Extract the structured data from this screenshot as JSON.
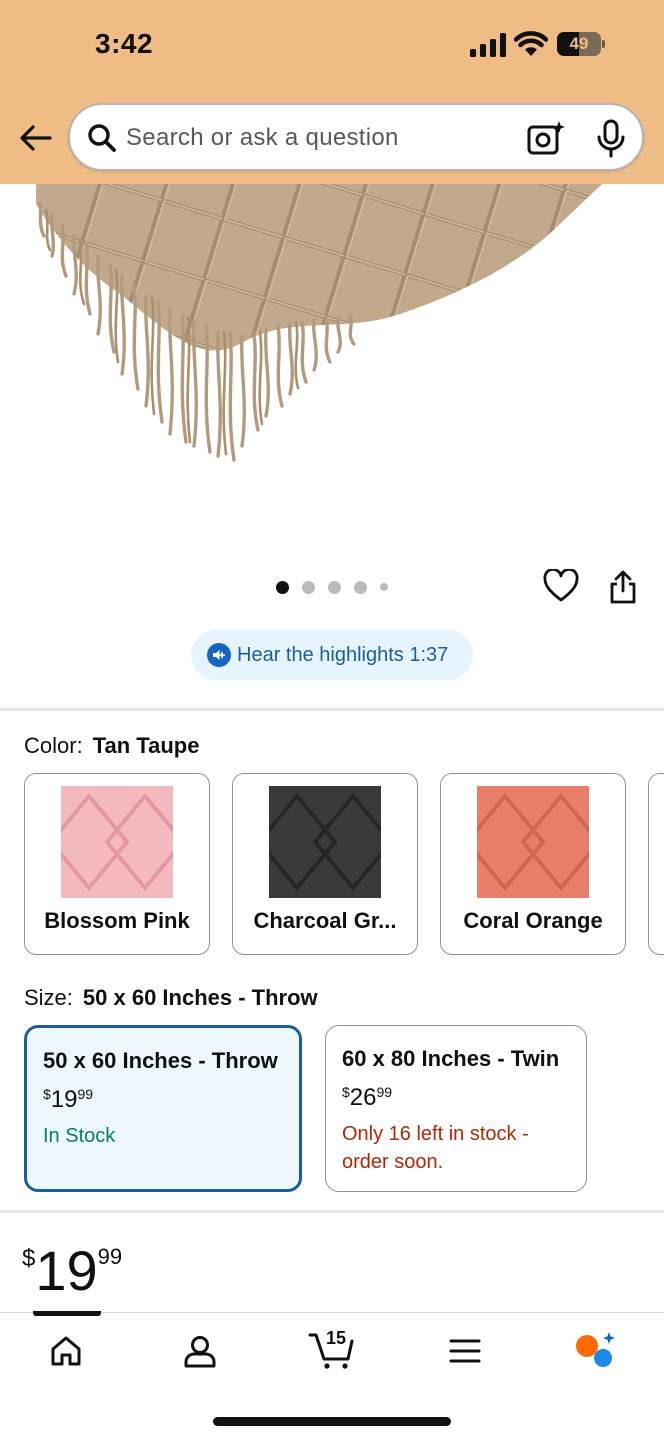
{
  "status_bar": {
    "time": "3:42",
    "battery": "49"
  },
  "search": {
    "placeholder": "Search or ask a question"
  },
  "gallery": {
    "image_alt": "Tan Taupe knitted throw blanket with fringe",
    "dots_total": 5,
    "active_dot": 1
  },
  "highlights": {
    "label": "Hear the highlights 1:37"
  },
  "color": {
    "label": "Color:",
    "selected": "Tan Taupe",
    "options": [
      {
        "name": "Blossom Pink",
        "color": "#f4b8bf"
      },
      {
        "name": "Charcoal Gr...",
        "color": "#3a3a3a"
      },
      {
        "name": "Coral Orange",
        "color": "#e97f68"
      }
    ]
  },
  "size": {
    "label": "Size:",
    "selected": "50 x 60 Inches - Throw",
    "options": [
      {
        "title": "50 x 60 Inches - Throw",
        "price_symbol": "$",
        "price_whole": "19",
        "price_cents": "99",
        "stock": "In Stock"
      },
      {
        "title": "60 x 80 Inches - Twin",
        "price_symbol": "$",
        "price_whole": "26",
        "price_cents": "99",
        "stock": "Only 16 left in stock - order soon."
      }
    ]
  },
  "price": {
    "symbol": "$",
    "whole": "19",
    "cents": "99"
  },
  "nav": {
    "cart_count": "15"
  },
  "colors": {
    "header_bg": "#efbc85",
    "link_blue": "#1f5d99",
    "in_stock_green": "#067d62",
    "low_stock_red": "#b12704"
  }
}
